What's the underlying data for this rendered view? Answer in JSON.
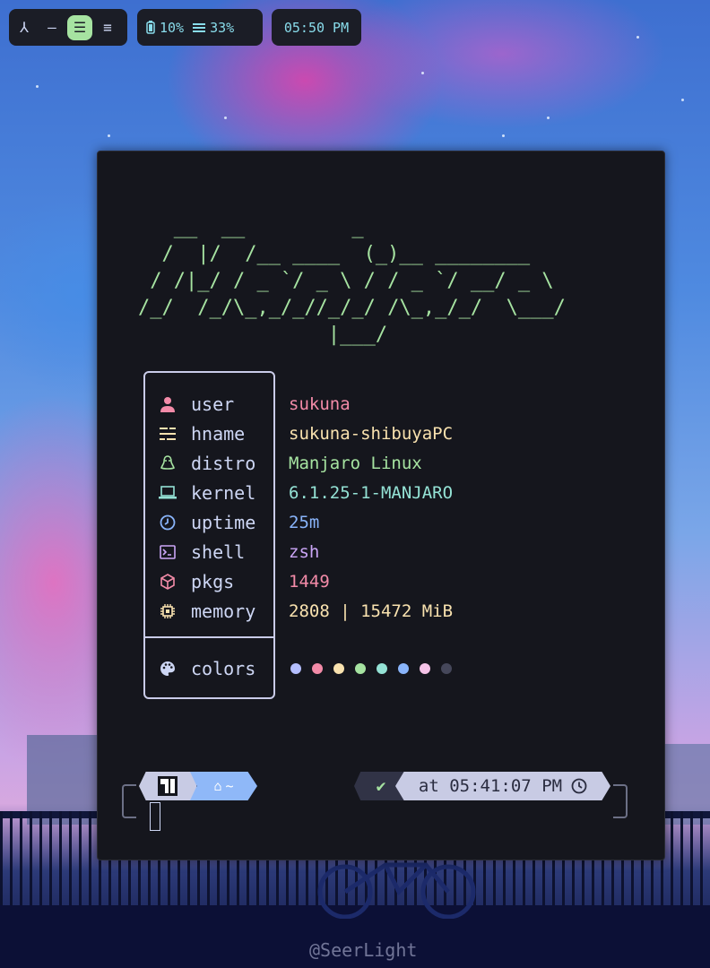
{
  "topbar": {
    "workspaces": [
      {
        "glyph": "⅄",
        "active": false
      },
      {
        "glyph": "—",
        "active": false
      },
      {
        "glyph": "☰",
        "active": true
      },
      {
        "glyph": "≡",
        "active": false
      }
    ],
    "battery": "10%",
    "memory": "33%",
    "clock": "05:50 PM"
  },
  "ascii_logo": [
    "   __  __         _",
    "  /  |/  /__ ____  (_)__ ________",
    " / /|_/ / _ `/ _ \\ / / _ `/ __/ _ \\",
    "/_/  /_/\\_,_/_//_/_/ /\\_,_/_/  \\___/",
    "                |___/"
  ],
  "info": [
    {
      "icon": "user-icon",
      "label": "user",
      "value": "sukuna",
      "color": "#f38ba8"
    },
    {
      "icon": "hostname-icon",
      "label": "hname",
      "value": "sukuna-shibuyaPC",
      "color": "#f9e2af"
    },
    {
      "icon": "distro-icon",
      "label": "distro",
      "value": "Manjaro Linux",
      "color": "#a6e3a1"
    },
    {
      "icon": "kernel-icon",
      "label": "kernel",
      "value": "6.1.25-1-MANJARO",
      "color": "#94e2d5"
    },
    {
      "icon": "uptime-icon",
      "label": "uptime",
      "value": "25m",
      "color": "#89b4fa"
    },
    {
      "icon": "shell-icon",
      "label": "shell",
      "value": "zsh",
      "color": "#cba6f7"
    },
    {
      "icon": "package-icon",
      "label": "pkgs",
      "value": "1449",
      "color": "#f38ba8"
    },
    {
      "icon": "memory-chip-icon",
      "label": "memory",
      "value": "2808 | 15472 MiB",
      "color": "#f9e2af"
    }
  ],
  "colors_row": {
    "label": "colors",
    "palette": [
      "#b4befe",
      "#f38ba8",
      "#f9e2af",
      "#a6e3a1",
      "#94e2d5",
      "#89b4fa",
      "#f5c2e7",
      "#45475a"
    ]
  },
  "prompt": {
    "dir": "~",
    "status": "✔",
    "time": "at 05:41:07 PM"
  },
  "watermark": "@SeerLight"
}
